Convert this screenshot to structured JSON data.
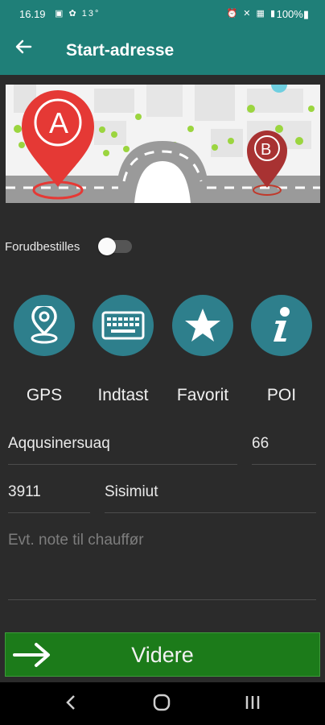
{
  "status_bar": {
    "time": "16.19",
    "left_icons": "▣ ✿ 13°",
    "right_icons": "⏰ ✕ ▦ ▮",
    "battery": "100%▮"
  },
  "app_bar": {
    "back_icon": "arrow-left-icon",
    "title": "Start-adresse"
  },
  "banner": {
    "marker_a": "A",
    "marker_b": "B"
  },
  "preorder": {
    "label": "Forudbestilles",
    "enabled": false
  },
  "actions": [
    {
      "label": "GPS",
      "icon": "location-pin-icon"
    },
    {
      "label": "Indtast",
      "icon": "keyboard-icon"
    },
    {
      "label": "Favorit",
      "icon": "star-icon"
    },
    {
      "label": "POI",
      "icon": "info-icon"
    }
  ],
  "address": {
    "street": "Aqqusinersuaq",
    "number": "66",
    "postal_code": "3911",
    "city": "Sisimiut",
    "note_placeholder": "Evt. note til chauffør"
  },
  "continue_button": {
    "label": "Videre"
  },
  "colors": {
    "header": "#1f7f78",
    "background": "#2b2b2b",
    "icon_circle": "#2e7f8c",
    "button": "#1c7b1a",
    "marker_a": "#e53935",
    "marker_b": "#a83232"
  }
}
